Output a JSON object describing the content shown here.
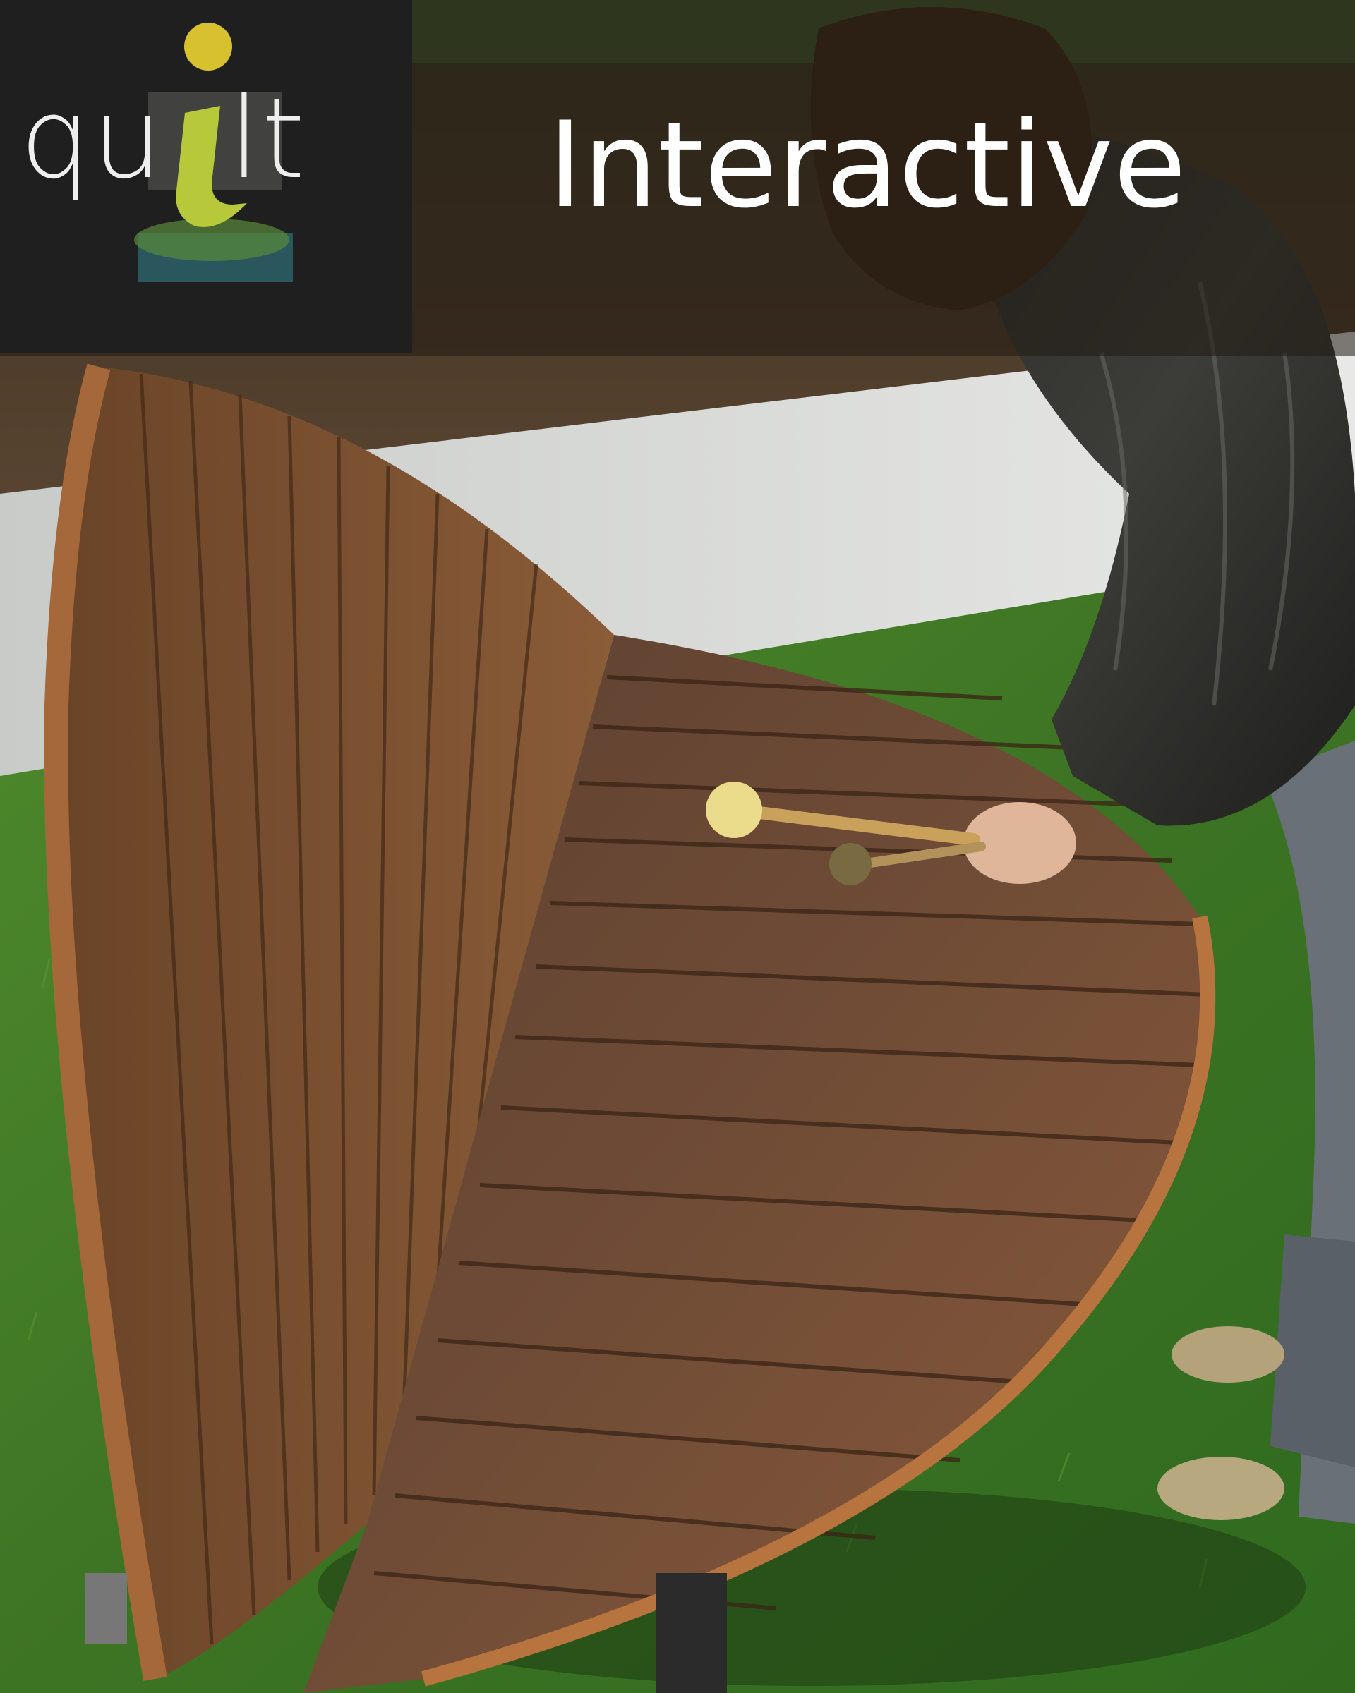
{
  "logo": {
    "text_left": "qu",
    "text_right": "lt",
    "accent_letter": "i",
    "accent_color": "#b7c83a",
    "background_color": "#1f1f1f"
  },
  "header": {
    "title": "Interactive",
    "title_color": "#ffffff"
  },
  "photo": {
    "subject": "person striking a curved wooden musical bench with a mallet on grass"
  }
}
